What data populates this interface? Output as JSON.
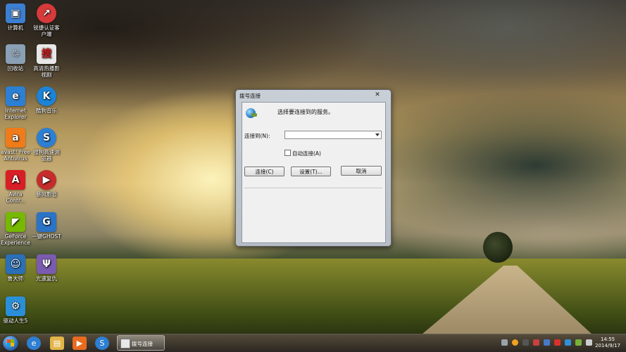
{
  "desktop": {
    "icons": [
      {
        "label": "计算机",
        "glyph": "▣",
        "color": "#3c7fd1"
      },
      {
        "label": "锐捷认证客户端",
        "glyph": "↗",
        "color": "#d63a3a"
      },
      {
        "label": "回收站",
        "glyph": "♲",
        "color": "#8aa0b4"
      },
      {
        "label": "高清热播影视剧",
        "glyph": "搜",
        "color": "#e8e8e8"
      },
      {
        "label": "Internet Explorer",
        "glyph": "e",
        "color": "#2d7fd3"
      },
      {
        "label": "酷狗音乐",
        "glyph": "K",
        "color": "#1b84d8"
      },
      {
        "label": "avast! Free Antivirus",
        "glyph": "a",
        "color": "#f07b1a"
      },
      {
        "label": "搜狗高速浏览器",
        "glyph": "S",
        "color": "#2d7fd3"
      },
      {
        "label": "Avira Contr...",
        "glyph": "A",
        "color": "#d81f26"
      },
      {
        "label": "暴风影音",
        "glyph": "▶",
        "color": "#c52c2c"
      },
      {
        "label": "GeForce Experience",
        "glyph": "◤",
        "color": "#76b900"
      },
      {
        "label": "一键GHOST",
        "glyph": "G",
        "color": "#2a73c7"
      },
      {
        "label": "鲁大师",
        "glyph": "☺",
        "color": "#2b6fb8"
      },
      {
        "label": "光速复仇",
        "glyph": "Ψ",
        "color": "#7a5bb0"
      },
      {
        "label": "驱动人生5",
        "glyph": "⚙",
        "color": "#2b8fd8"
      }
    ]
  },
  "dialog": {
    "title": "拨号连接",
    "close_glyph": "✕",
    "heading": "选择要连接到的服务。",
    "connect_to_label": "连接到(N):",
    "connect_to_value": "",
    "auto_connect_label": "自动连接(A)",
    "auto_connect_checked": false,
    "buttons": {
      "connect": "连接(C)",
      "settings": "设置(T)...",
      "cancel": "取消"
    }
  },
  "taskbar": {
    "pinned": [
      {
        "name": "ie",
        "glyph": "e",
        "color": "#2d7fd3"
      },
      {
        "name": "explorer",
        "glyph": "▤",
        "color": "#e2b54a"
      },
      {
        "name": "media-player",
        "glyph": "▶",
        "color": "#e86b1f"
      },
      {
        "name": "sogou-browser",
        "glyph": "S",
        "color": "#2d7fd3"
      }
    ],
    "active_task": "拨号连接",
    "tray_colors": [
      "#9aa3ad",
      "#f1a21f",
      "#555555",
      "#c94040",
      "#4a78c8",
      "#d7322d",
      "#2f8fd8",
      "#79b13a",
      "#cccccc",
      "#cccccc"
    ],
    "clock_time": "14:55",
    "clock_date": "2014/9/17"
  }
}
